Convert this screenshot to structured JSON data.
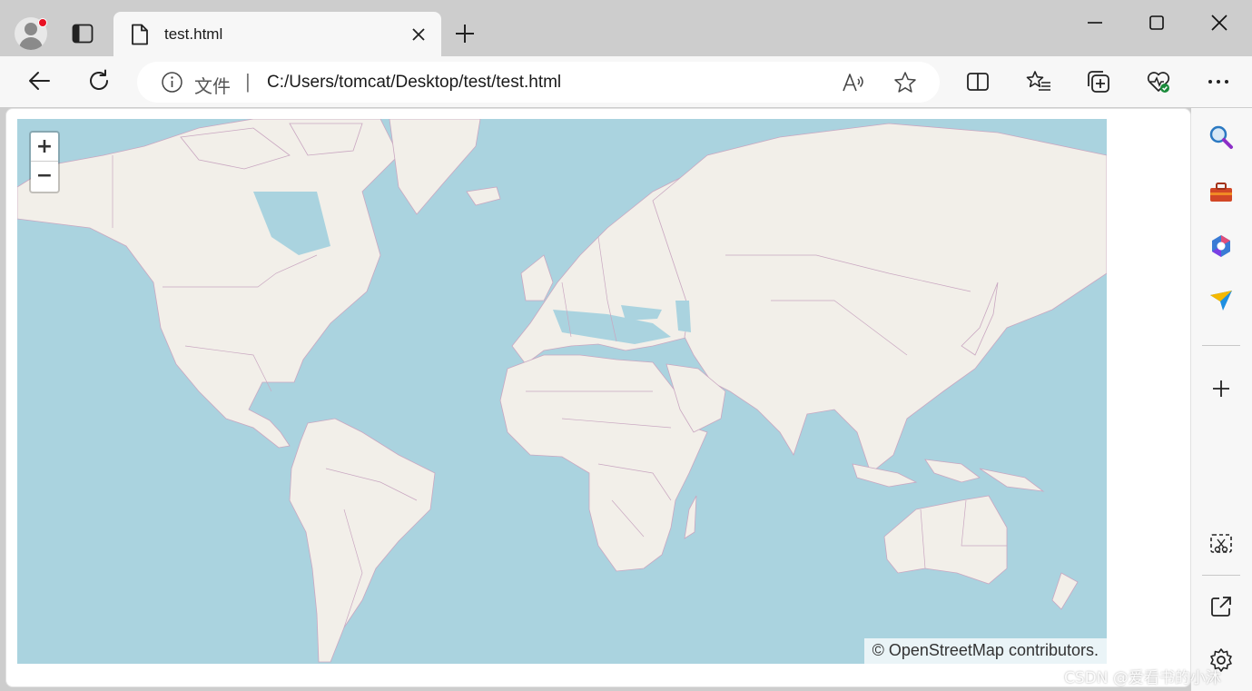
{
  "browser": {
    "tab": {
      "title": "test.html"
    },
    "address": {
      "scheme_label": "文件",
      "separator": "|",
      "url": "C:/Users/tomcat/Desktop/test/test.html"
    }
  },
  "map": {
    "zoom_in_label": "+",
    "zoom_out_label": "−",
    "attribution": "© OpenStreetMap contributors.",
    "colors": {
      "water": "#aad3df",
      "land": "#f2efe9",
      "border": "#c9a7c1"
    }
  },
  "watermark": "CSDN @爱看书的小沐",
  "icons": {
    "titlebar": [
      "profile-avatar-icon",
      "tab-actions-icon",
      "document-icon",
      "close-icon",
      "plus-icon",
      "minimize-icon",
      "maximize-icon",
      "window-close-icon"
    ],
    "toolbar": [
      "back-arrow-icon",
      "refresh-icon",
      "info-icon",
      "read-aloud-icon",
      "star-icon",
      "split-screen-icon",
      "favorites-icon",
      "collections-icon",
      "browser-essentials-icon",
      "more-dots-icon"
    ],
    "sidebar": [
      "search-icon",
      "tools-icon",
      "office-icon",
      "send-icon",
      "plus-icon",
      "screenshot-icon",
      "open-external-icon",
      "settings-gear-icon"
    ]
  }
}
